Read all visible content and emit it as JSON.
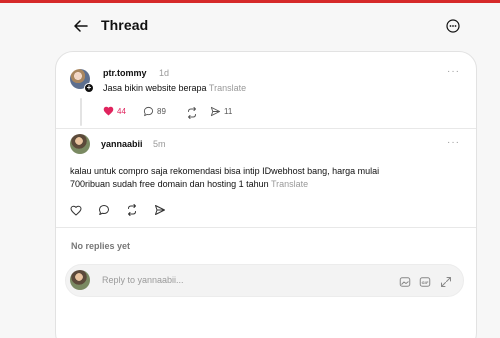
{
  "header": {
    "title": "Thread"
  },
  "original_post": {
    "username": "ptr.tommy",
    "time": "1d",
    "text": "Jasa bikin website berapa",
    "translate": "Translate",
    "likes": "44",
    "comments": "89",
    "shares": "11",
    "more": "···"
  },
  "reply": {
    "username": "yannaabii",
    "time": "5m",
    "text_line1": "kalau untuk compro saja rekomendasi bisa intip IDwebhost bang, harga mulai",
    "text_line2": "700ribuan sudah free domain dan hosting 1 tahun",
    "translate": "Translate",
    "more": "···"
  },
  "replies_section": {
    "empty_label": "No replies yet"
  },
  "composer": {
    "placeholder": "Reply to yannaabii..."
  },
  "colors": {
    "accent_red": "#d62a2a",
    "like_red": "#e0245e"
  },
  "icons": {
    "back": "arrow-left-icon",
    "more": "more-circle-icon",
    "like": "heart-icon",
    "comment": "comment-bubble-icon",
    "repost": "repost-icon",
    "share": "send-icon",
    "image": "image-icon",
    "gif": "gif-icon",
    "expand": "expand-icon"
  }
}
